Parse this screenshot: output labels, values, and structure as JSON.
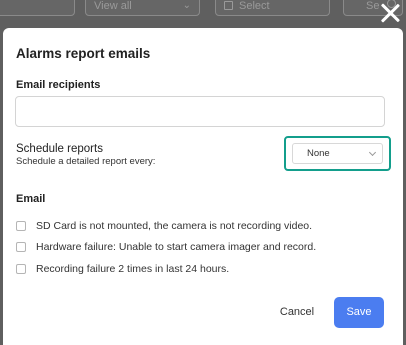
{
  "background": {
    "filter_value": "View all",
    "date_placeholder": "Select",
    "search_placeholder": "Se"
  },
  "modal": {
    "title": "Alarms report emails",
    "email_recipients_label": "Email recipients",
    "email_recipients_value": "",
    "schedule_title": "Schedule reports",
    "schedule_subtitle": "Schedule a detailed report every:",
    "schedule_selected": "None",
    "email_section_label": "Email",
    "options": [
      {
        "label": "SD Card is not mounted, the camera is not recording video.",
        "checked": false
      },
      {
        "label": "Hardware failure: Unable to start camera imager and record.",
        "checked": false
      },
      {
        "label": "Recording failure 2 times in last 24 hours.",
        "checked": false
      }
    ],
    "cancel_label": "Cancel",
    "save_label": "Save"
  },
  "colors": {
    "accent_highlight": "#139e8c",
    "primary_button": "#4b7df0",
    "overlay": "#5f5f5f"
  }
}
